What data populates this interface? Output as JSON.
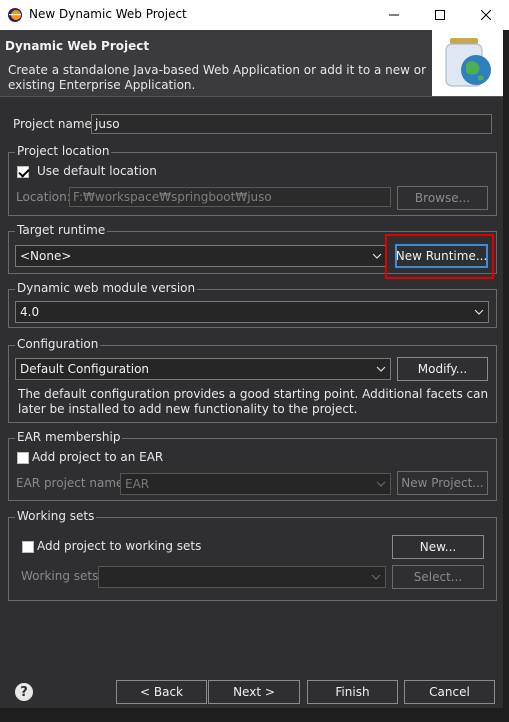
{
  "window": {
    "title": "New Dynamic Web Project"
  },
  "banner": {
    "title": "Dynamic Web Project",
    "description": "Create a standalone Java-based Web Application or add it to a new or existing Enterprise Application."
  },
  "project_name": {
    "label": "Project name:",
    "value": "juso"
  },
  "project_location": {
    "group_label": "Project location",
    "use_default_label": "Use default location",
    "use_default_checked": true,
    "location_label": "Location:",
    "location_value": "F:₩workspace₩springboot₩juso",
    "browse_label": "Browse..."
  },
  "target_runtime": {
    "group_label": "Target runtime",
    "selected": "<None>",
    "new_runtime_label": "New Runtime..."
  },
  "module_version": {
    "group_label": "Dynamic web module version",
    "selected": "4.0"
  },
  "configuration": {
    "group_label": "Configuration",
    "selected": "Default Configuration",
    "modify_label": "Modify...",
    "description": "The default configuration provides a good starting point. Additional facets can later be installed to add new functionality to the project."
  },
  "ear": {
    "group_label": "EAR membership",
    "add_label": "Add project to an EAR",
    "add_checked": false,
    "name_label": "EAR project name:",
    "name_value": "EAR",
    "new_project_label": "New Project..."
  },
  "working_sets": {
    "group_label": "Working sets",
    "add_label": "Add project to working sets",
    "add_checked": false,
    "new_label": "New...",
    "sets_label": "Working sets:",
    "select_label": "Select..."
  },
  "footer": {
    "help_icon": "?",
    "back_label": "< Back",
    "next_label": "Next >",
    "finish_label": "Finish",
    "cancel_label": "Cancel"
  },
  "colors": {
    "highlight": "#e00000",
    "focus": "#3b8fd9",
    "background": "#2f2f31"
  }
}
